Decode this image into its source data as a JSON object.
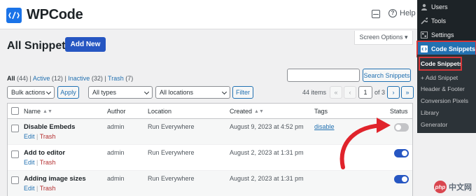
{
  "header": {
    "brand": "WPCode",
    "help_label": "Help"
  },
  "page": {
    "title": "All Snippets",
    "add_new_label": "Add New",
    "screen_options_label": "Screen Options ▾"
  },
  "views": {
    "all": "All",
    "all_count": "(44)",
    "active": "Active",
    "active_count": "(12)",
    "inactive": "Inactive",
    "inactive_count": "(32)",
    "trash": "Trash",
    "trash_count": "(7)"
  },
  "search": {
    "button_label": "Search Snippets",
    "value": ""
  },
  "filters": {
    "bulk_actions": "Bulk actions",
    "apply_label": "Apply",
    "types": "All types",
    "locations": "All locations",
    "filter_label": "Filter"
  },
  "pagination": {
    "items": "44 items",
    "first": "«",
    "prev": "‹",
    "current": "1",
    "of": "of 3",
    "next": "›",
    "last": "»"
  },
  "table": {
    "columns": {
      "name": "Name",
      "author": "Author",
      "location": "Location",
      "created": "Created",
      "tags": "Tags",
      "status": "Status"
    },
    "rows": [
      {
        "name": "Disable Embeds",
        "edit": "Edit",
        "trash": "Trash",
        "author": "admin",
        "location": "Run Everywhere",
        "created": "August 9, 2023 at 4:52 pm",
        "tag": "disable",
        "status": "inactive"
      },
      {
        "name": "Add to editor",
        "edit": "Edit",
        "trash": "Trash",
        "author": "admin",
        "location": "Run Everywhere",
        "created": "August 2, 2023 at 1:31 pm",
        "tag": "",
        "status": "active"
      },
      {
        "name": "Adding image sizes",
        "edit": "Edit",
        "trash": "Trash",
        "author": "admin",
        "location": "Run Everywhere",
        "created": "August 2, 2023 at 1:31 pm",
        "tag": "",
        "status": "active"
      }
    ]
  },
  "admin_menu": {
    "users": "Users",
    "tools": "Tools",
    "settings": "Settings",
    "code_snippets": "Code Snippets",
    "submenu": [
      "Code Snippets",
      "+ Add Snippet",
      "Header & Footer",
      "Conversion Pixels",
      "Library",
      "Generator"
    ]
  },
  "watermark": "中文网",
  "colors": {
    "accent": "#2656c2",
    "link": "#2271b1",
    "trash": "#b32d2e",
    "highlight": "#d63638",
    "admin_bg": "#1d2327"
  }
}
